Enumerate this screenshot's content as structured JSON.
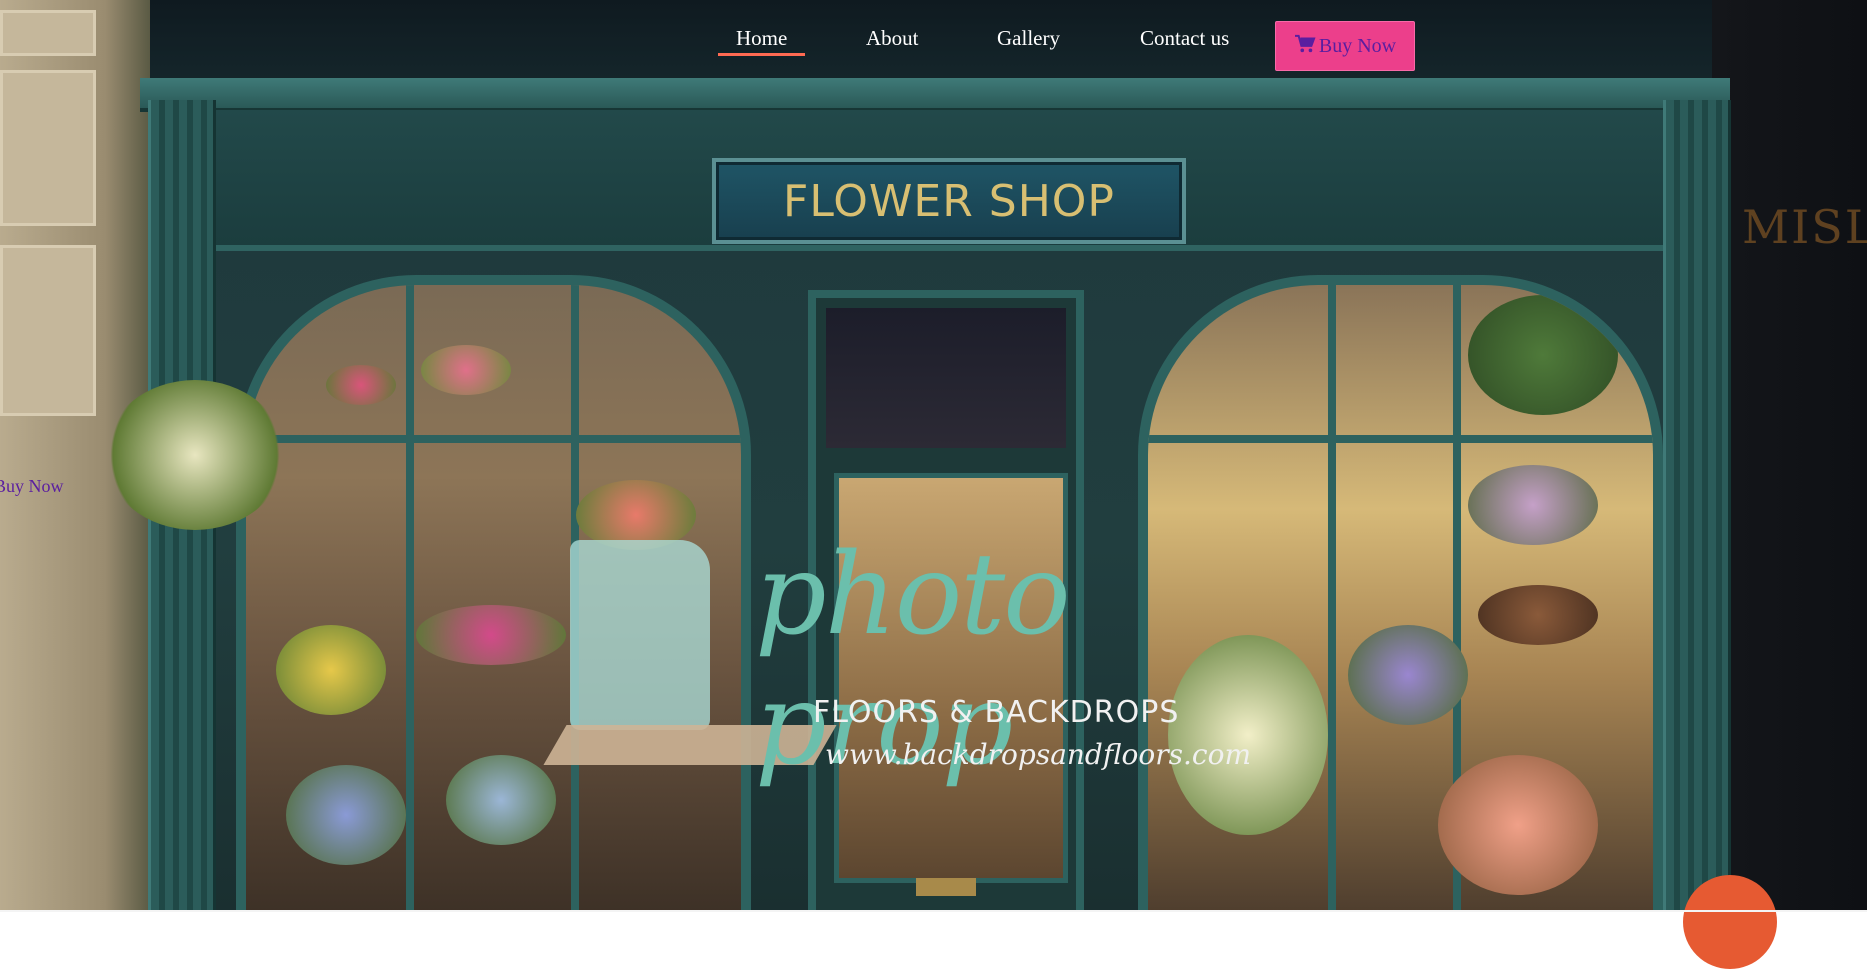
{
  "nav": {
    "items": [
      {
        "label": "Home",
        "active": true
      },
      {
        "label": "About",
        "active": false
      },
      {
        "label": "Gallery",
        "active": false
      },
      {
        "label": "Contact us",
        "active": false
      }
    ],
    "buy_button": {
      "label": "Buy Now",
      "icon": "cart-icon"
    }
  },
  "hero": {
    "sign_text": "FLOWER SHOP",
    "watermark": {
      "script": "photo prop",
      "tagline": "FLOORS & BACKDROPS",
      "url": "www.backdropsandfloors.com"
    }
  },
  "side_link": {
    "label": "Buy Now"
  },
  "colors": {
    "accent_underline": "#ff6a52",
    "buy_button_bg": "#ec3f8b",
    "link_purple": "#5a1ea0",
    "fab": "#e65a32"
  }
}
